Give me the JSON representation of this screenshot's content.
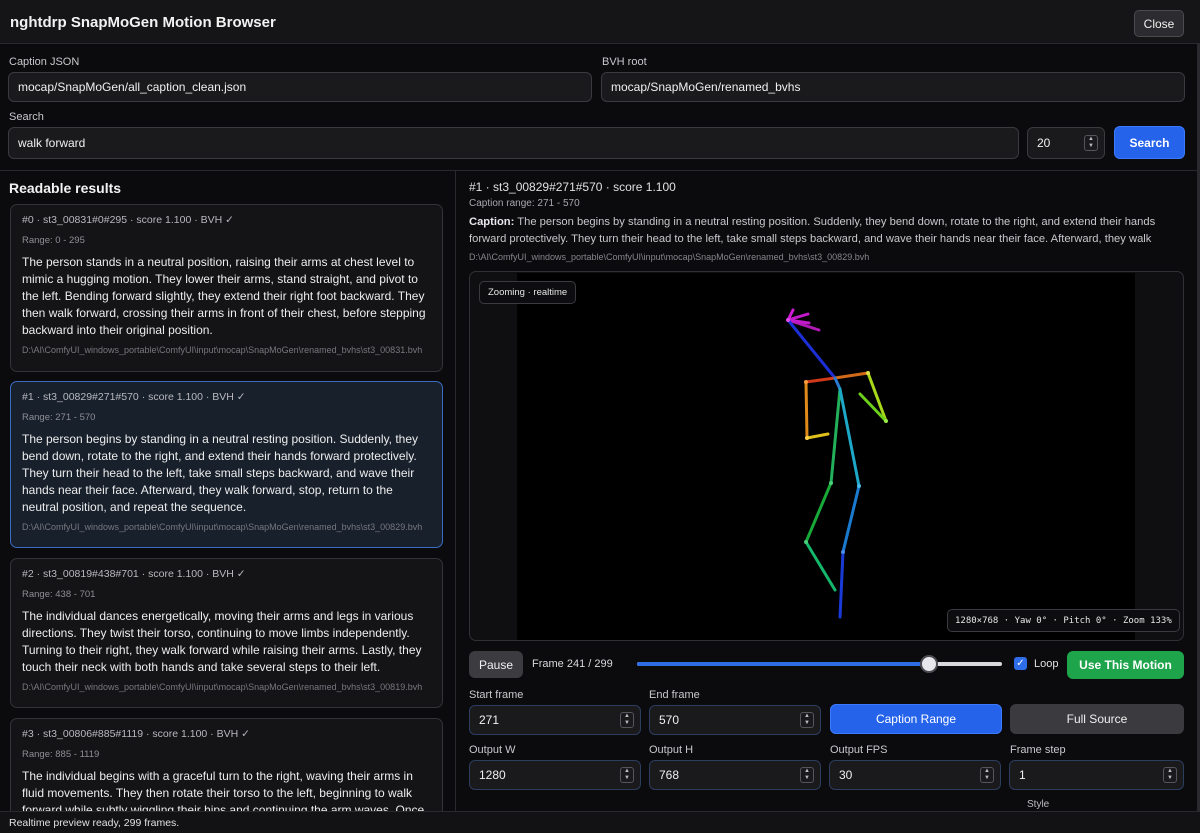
{
  "window": {
    "title": "nghtdrp SnapMoGen Motion Browser",
    "close_label": "Close"
  },
  "inputs": {
    "caption_json_label": "Caption JSON",
    "caption_json_value": "mocap/SnapMoGen/all_caption_clean.json",
    "bvh_root_label": "BVH root",
    "bvh_root_value": "mocap/SnapMoGen/renamed_bvhs",
    "search_label": "Search",
    "search_value": "walk forward",
    "limit_value": "20",
    "search_button": "Search"
  },
  "results": {
    "title": "Readable results",
    "items": [
      {
        "head": "#0 · st3_00831#0#295 · score 1.100 · BVH ✓",
        "range": "Range: 0 - 295",
        "text": "The person stands in a neutral position, raising their arms at chest level to mimic a hugging motion. They lower their arms, stand straight, and pivot to the left. Bending forward slightly, they extend their right foot backward. They then walk forward, crossing their arms in front of their chest, before stepping backward into their original position.",
        "path": "D:\\AI\\ComfyUI_windows_portable\\ComfyUI\\input\\mocap\\SnapMoGen\\renamed_bvhs\\st3_00831.bvh"
      },
      {
        "head": "#1 · st3_00829#271#570 · score 1.100 · BVH ✓",
        "range": "Range: 271 - 570",
        "text": "The person begins by standing in a neutral resting position. Suddenly, they bend down, rotate to the right, and extend their hands forward protectively. They turn their head to the left, take small steps backward, and wave their hands near their face. Afterward, they walk forward, stop, return to the neutral position, and repeat the sequence.",
        "path": "D:\\AI\\ComfyUI_windows_portable\\ComfyUI\\input\\mocap\\SnapMoGen\\renamed_bvhs\\st3_00829.bvh"
      },
      {
        "head": "#2 · st3_00819#438#701 · score 1.100 · BVH ✓",
        "range": "Range: 438 - 701",
        "text": "The individual dances energetically, moving their arms and legs in various directions. They twist their torso, continuing to move limbs independently. Turning to their right, they walk forward while raising their arms. Lastly, they touch their neck with both hands and take several steps to their left.",
        "path": "D:\\AI\\ComfyUI_windows_portable\\ComfyUI\\input\\mocap\\SnapMoGen\\renamed_bvhs\\st3_00819.bvh"
      },
      {
        "head": "#3 · st3_00806#885#1119 · score 1.100 · BVH ✓",
        "range": "Range: 885 - 1119",
        "text": "The individual begins with a graceful turn to the right, waving their arms in fluid movements. They then rotate their torso to the left, beginning to walk forward while subtly wiggling their hips and continuing the arm waves. Once",
        "path": ""
      }
    ]
  },
  "detail": {
    "head": "#1 · st3_00829#271#570 · score 1.100",
    "range": "Caption range: 271 - 570",
    "caption_label": "Caption:",
    "caption_text": "The person begins by standing in a neutral resting position. Suddenly, they bend down, rotate to the right, and extend their hands forward protectively. They turn their head to the left, take small steps backward, and wave their hands near their face. Afterward, they walk",
    "path": "D:\\AI\\ComfyUI_windows_portable\\ComfyUI\\input\\mocap\\SnapMoGen\\renamed_bvhs\\st3_00829.bvh"
  },
  "viewer": {
    "mode_badge": "Zooming · realtime",
    "hud": "1280×768 · Yaw 0° · Pitch 0° · Zoom 133%"
  },
  "playback": {
    "pause_label": "Pause",
    "frame_text": "Frame 241 / 299",
    "progress": 0.8,
    "loop_label": "Loop",
    "loop_checked": true,
    "use_motion_label": "Use This Motion"
  },
  "params": {
    "start_frame_label": "Start frame",
    "start_frame_value": "271",
    "end_frame_label": "End frame",
    "end_frame_value": "570",
    "caption_range_button": "Caption Range",
    "full_source_button": "Full Source",
    "output_w_label": "Output W",
    "output_w_value": "1280",
    "output_h_label": "Output H",
    "output_h_value": "768",
    "output_fps_label": "Output FPS",
    "output_fps_value": "30",
    "frame_step_label": "Frame step",
    "frame_step_value": "1",
    "style_label": "Style"
  },
  "status": {
    "text": "Realtime preview ready, 299 frames."
  },
  "colors": {
    "accent": "#2563eb",
    "success": "#1ea44a"
  }
}
